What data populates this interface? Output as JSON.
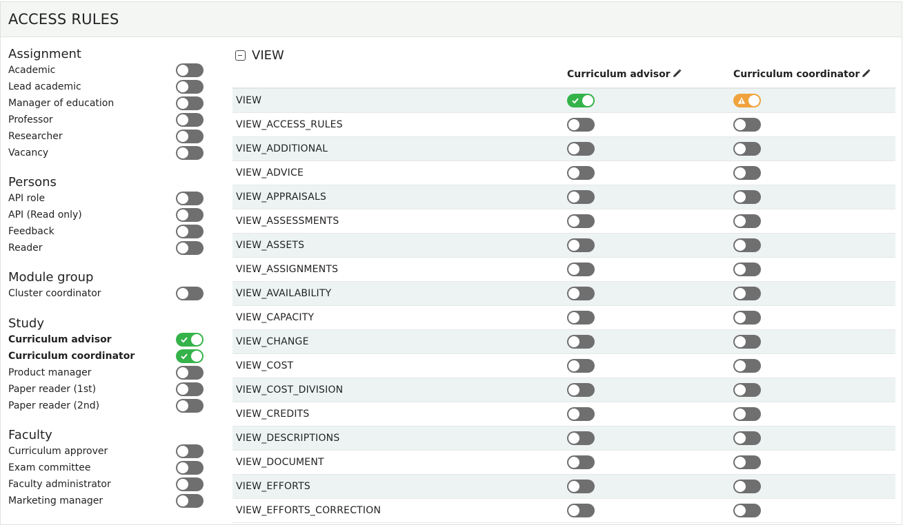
{
  "header": {
    "title": "ACCESS RULES"
  },
  "groups": [
    {
      "title": "Assignment",
      "roles": [
        {
          "label": "Academic",
          "state": "off"
        },
        {
          "label": "Lead academic",
          "state": "off"
        },
        {
          "label": "Manager of education",
          "state": "off"
        },
        {
          "label": "Professor",
          "state": "off"
        },
        {
          "label": "Researcher",
          "state": "off"
        },
        {
          "label": "Vacancy",
          "state": "off"
        }
      ]
    },
    {
      "title": "Persons",
      "roles": [
        {
          "label": "API role",
          "state": "off"
        },
        {
          "label": "API (Read only)",
          "state": "off"
        },
        {
          "label": "Feedback",
          "state": "off"
        },
        {
          "label": "Reader",
          "state": "off"
        }
      ]
    },
    {
      "title": "Module group",
      "roles": [
        {
          "label": "Cluster coordinator",
          "state": "off"
        }
      ]
    },
    {
      "title": "Study",
      "roles": [
        {
          "label": "Curriculum advisor",
          "state": "on"
        },
        {
          "label": "Curriculum coordinator",
          "state": "on"
        },
        {
          "label": "Product manager",
          "state": "off"
        },
        {
          "label": "Paper reader (1st)",
          "state": "off"
        },
        {
          "label": "Paper reader (2nd)",
          "state": "off"
        }
      ]
    },
    {
      "title": "Faculty",
      "roles": [
        {
          "label": "Curriculum approver",
          "state": "off"
        },
        {
          "label": "Exam committee",
          "state": "off"
        },
        {
          "label": "Faculty administrator",
          "state": "off"
        },
        {
          "label": "Marketing manager",
          "state": "off"
        }
      ]
    }
  ],
  "section": {
    "title": "VIEW",
    "icon": "collapse-icon"
  },
  "columns": [
    "Curriculum advisor",
    "Curriculum coordinator"
  ],
  "permissions": [
    {
      "name": "VIEW",
      "a": "on",
      "b": "partial"
    },
    {
      "name": "VIEW_ACCESS_RULES",
      "a": "off",
      "b": "off"
    },
    {
      "name": "VIEW_ADDITIONAL",
      "a": "off",
      "b": "off"
    },
    {
      "name": "VIEW_ADVICE",
      "a": "off",
      "b": "off"
    },
    {
      "name": "VIEW_APPRAISALS",
      "a": "off",
      "b": "off"
    },
    {
      "name": "VIEW_ASSESSMENTS",
      "a": "off",
      "b": "off"
    },
    {
      "name": "VIEW_ASSETS",
      "a": "off",
      "b": "off"
    },
    {
      "name": "VIEW_ASSIGNMENTS",
      "a": "off",
      "b": "off"
    },
    {
      "name": "VIEW_AVAILABILITY",
      "a": "off",
      "b": "off"
    },
    {
      "name": "VIEW_CAPACITY",
      "a": "off",
      "b": "off"
    },
    {
      "name": "VIEW_CHANGE",
      "a": "off",
      "b": "off"
    },
    {
      "name": "VIEW_COST",
      "a": "off",
      "b": "off"
    },
    {
      "name": "VIEW_COST_DIVISION",
      "a": "off",
      "b": "off"
    },
    {
      "name": "VIEW_CREDITS",
      "a": "off",
      "b": "off"
    },
    {
      "name": "VIEW_DESCRIPTIONS",
      "a": "off",
      "b": "off"
    },
    {
      "name": "VIEW_DOCUMENT",
      "a": "off",
      "b": "off"
    },
    {
      "name": "VIEW_EFFORTS",
      "a": "off",
      "b": "off"
    },
    {
      "name": "VIEW_EFFORTS_CORRECTION",
      "a": "off",
      "b": "off"
    }
  ],
  "colors": {
    "on": "#35b34a",
    "off": "#6f6f6f",
    "partial": "#f0a33c",
    "stripe": "#edf3f3"
  }
}
